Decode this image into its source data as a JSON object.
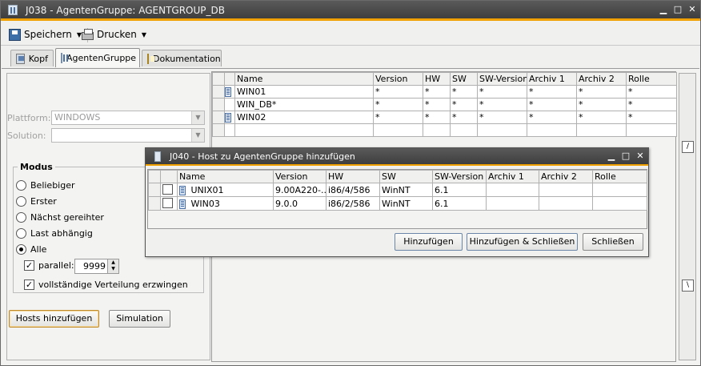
{
  "window": {
    "title": "J038 - AgentenGruppe: AGENTGROUP_DB"
  },
  "toolbar": {
    "save_label": "Speichern",
    "print_label": "Drucken"
  },
  "tabs": [
    {
      "label": "Kopf"
    },
    {
      "label": "AgentenGruppe"
    },
    {
      "label": "Dokumentation"
    }
  ],
  "form": {
    "plattform_label": "Plattform:",
    "plattform_value": "WINDOWS",
    "solution_label": "Solution:",
    "solution_value": "",
    "modus_label": "Modus",
    "modes": [
      "Beliebiger",
      "Erster",
      "Nächst gereihter",
      "Last abhängig",
      "Alle"
    ],
    "selected_mode": "Alle",
    "parallel_label": "parallel:",
    "parallel_checked": true,
    "parallel_value": "9999",
    "force_label": "vollständige Verteilung erzwingen",
    "force_checked": true,
    "hosts_add_label": "Hosts hinzufügen",
    "simulation_label": "Simulation"
  },
  "grid": {
    "columns": [
      "Name",
      "Version",
      "HW",
      "SW",
      "SW-Version",
      "Archiv 1",
      "Archiv 2",
      "Rolle"
    ],
    "rows": [
      {
        "icon": true,
        "cells": [
          "WIN01",
          "*",
          "*",
          "*",
          "*",
          "*",
          "*",
          "*"
        ]
      },
      {
        "icon": false,
        "cells": [
          "WIN_DB*",
          "*",
          "*",
          "*",
          "*",
          "*",
          "*",
          "*"
        ]
      },
      {
        "icon": true,
        "cells": [
          "WIN02",
          "*",
          "*",
          "*",
          "*",
          "*",
          "*",
          "*"
        ]
      }
    ]
  },
  "sidebar": {
    "up_label": "/",
    "down_label": "\\"
  },
  "dialog": {
    "title": "J040 - Host zu AgentenGruppe hinzufügen",
    "columns": [
      "Name",
      "Version",
      "HW",
      "SW",
      "SW-Version",
      "Archiv 1",
      "Archiv 2",
      "Rolle"
    ],
    "rows": [
      {
        "cells": [
          "UNIX01",
          "9.00A220-...",
          "i86/4/586",
          "WinNT",
          "6.1",
          "",
          "",
          ""
        ]
      },
      {
        "cells": [
          "WIN03",
          "9.0.0",
          "i86/2/586",
          "WinNT",
          "6.1",
          "",
          "",
          ""
        ]
      }
    ],
    "add_label": "Hinzufügen",
    "add_close_label": "Hinzufügen & Schließen",
    "close_label": "Schließen"
  },
  "colors": {
    "accent": "#f0a000",
    "titlebar": "#4a4a4a"
  }
}
